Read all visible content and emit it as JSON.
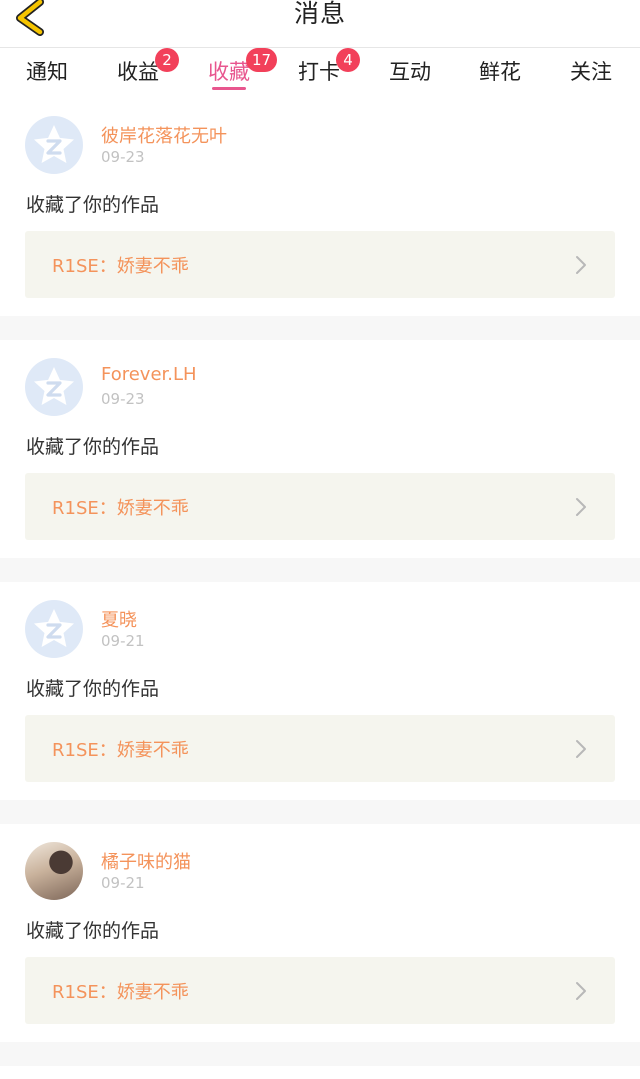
{
  "header": {
    "title": "消息"
  },
  "tabs": [
    {
      "label": "通知",
      "badge": ""
    },
    {
      "label": "收益",
      "badge": "2"
    },
    {
      "label": "收藏",
      "badge": "17"
    },
    {
      "label": "打卡",
      "badge": "4"
    },
    {
      "label": "互动",
      "badge": ""
    },
    {
      "label": "鲜花",
      "badge": ""
    },
    {
      "label": "关注",
      "badge": ""
    }
  ],
  "active_tab": "收藏",
  "notifications": [
    {
      "name": "彼岸花落花无叶",
      "date": "09-23",
      "action": "收藏了你的作品",
      "work_title": "R1SE：娇妻不乖",
      "avatar": "default-star-avatar"
    },
    {
      "name": "Forever.LH",
      "date": "09-23",
      "action": "收藏了你的作品",
      "work_title": "R1SE：娇妻不乖",
      "avatar": "default-star-avatar"
    },
    {
      "name": "夏晓",
      "date": "09-21",
      "action": "收藏了你的作品",
      "work_title": "R1SE：娇妻不乖",
      "avatar": "default-star-avatar"
    },
    {
      "name": "橘子味的猫",
      "date": "09-21",
      "action": "收藏了你的作品",
      "work_title": "R1SE：娇妻不乖",
      "avatar": "photo-avatar"
    }
  ],
  "colors": {
    "accent": "#e8568e",
    "badge": "#f2405a",
    "name": "#f4935b",
    "back_arrow": "#f5c400"
  }
}
